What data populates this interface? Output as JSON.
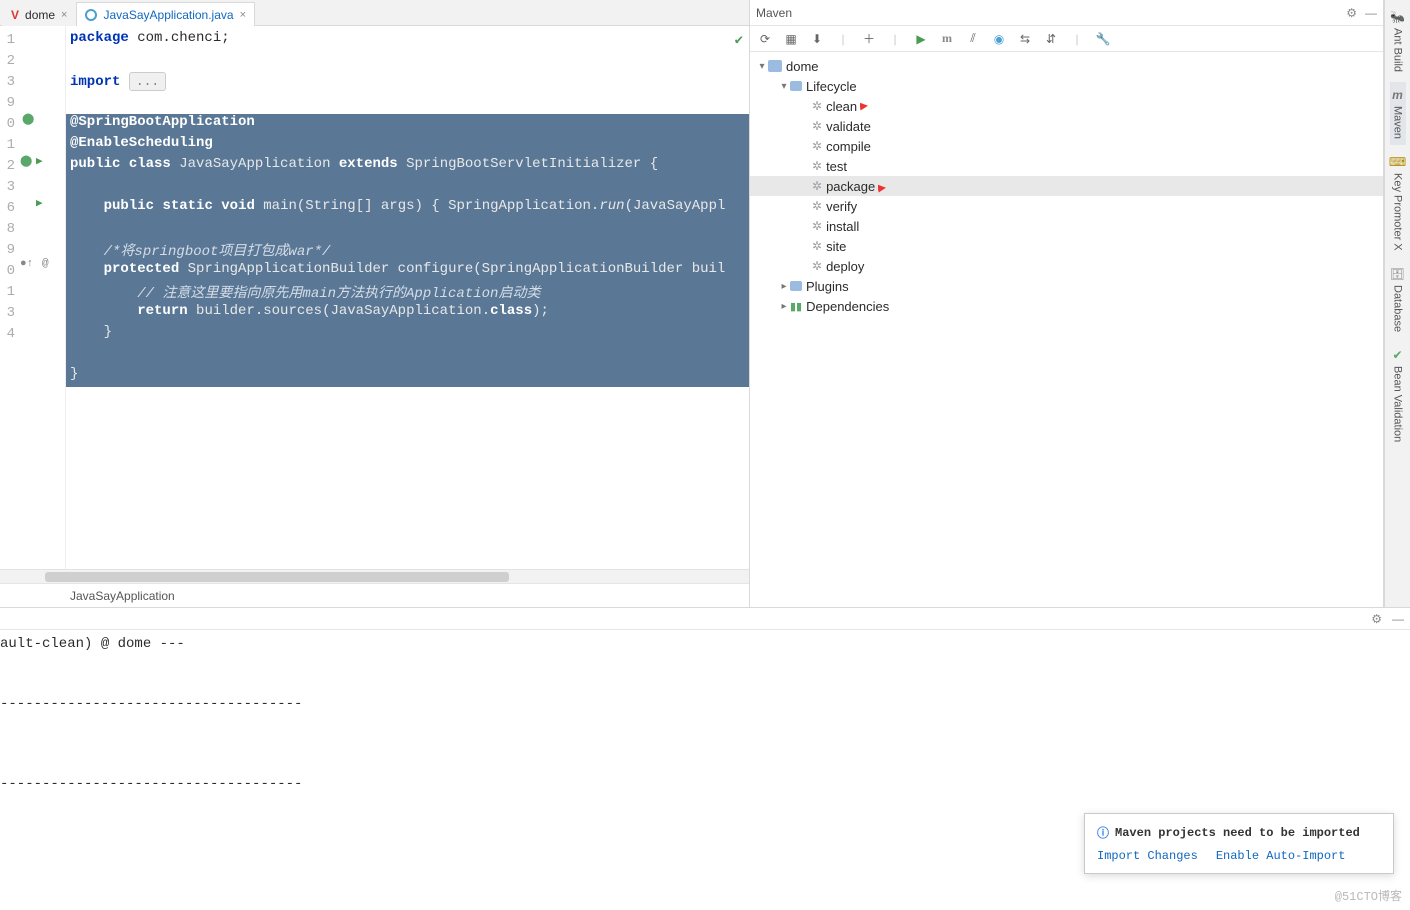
{
  "tabs": [
    {
      "label": "dome",
      "icon": "v",
      "active": false
    },
    {
      "label": "JavaSayApplication.java",
      "icon": "c",
      "active": true
    }
  ],
  "gutter_start": 1,
  "gutter_count": 14,
  "code": {
    "l1": "package com.chenci;",
    "l3a": "import ",
    "l3b": "...",
    "l5": "@SpringBootApplication",
    "l6": "@EnableScheduling",
    "l7": "public class JavaSayApplication extends SpringBootServletInitializer {",
    "l9": "    public static void main(String[] args) { SpringApplication.run(JavaSayAppl",
    "l11": "    /*将springboot项目打包成war*/",
    "l12": "    protected SpringApplicationBuilder configure(SpringApplicationBuilder buil",
    "l13": "        // 注意这里要指向原先用main方法执行的Application启动类",
    "l14": "        return builder.sources(JavaSayApplication.class);",
    "l15": "    }",
    "l17": "}"
  },
  "status": "JavaSayApplication",
  "maven": {
    "title": "Maven",
    "project": "dome",
    "lifecycle_label": "Lifecycle",
    "lifecycle": [
      "clean",
      "validate",
      "compile",
      "test",
      "package",
      "verify",
      "install",
      "site",
      "deploy"
    ],
    "selected": "package",
    "plugins": "Plugins",
    "dependencies": "Dependencies"
  },
  "right_tools": [
    "Ant Build",
    "Maven",
    "Key Promoter X",
    "Database",
    "Bean Validation"
  ],
  "console": {
    "l1": "ault-clean) @ dome ---",
    "dashes": "------------------------------------"
  },
  "notification": {
    "title": "Maven projects need to be imported",
    "action1": "Import Changes",
    "action2": "Enable Auto-Import"
  },
  "watermark": "@51CTO博客"
}
